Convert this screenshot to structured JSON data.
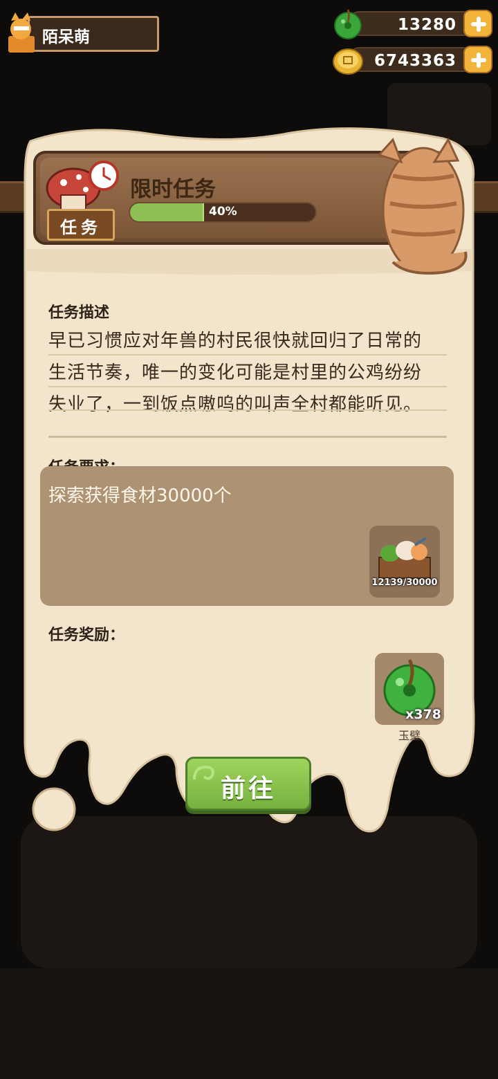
{
  "player": {
    "name": "陌呆萌"
  },
  "currencies": {
    "jade": {
      "value": "13280",
      "icon": "jade-disc-icon"
    },
    "coin": {
      "value": "6743363",
      "icon": "coin-icon"
    }
  },
  "task": {
    "badge_label": "任务",
    "title": "限时任务",
    "progress_percent": 40,
    "progress_text": "40%",
    "description_label": "任务描述",
    "description_lines": [
      "早已习惯应对年兽的村民很快就回归了日常的",
      "生活节奏，唯一的变化可能是村里的公鸡纷纷",
      "失业了，一到饭点嗷呜的叫声全村都能听见。"
    ],
    "requirement_label": "任务要求：",
    "requirement_text": "探索获得食材30000个",
    "requirement_item": {
      "icon": "ingredient-crate-icon",
      "progress": "12139/30000"
    },
    "reward_label": "任务奖励：",
    "reward_item": {
      "icon": "jade-disc-icon",
      "quantity": "x378",
      "name": "玉璧"
    },
    "go_button_label": "前往"
  },
  "colors": {
    "parchment": "#f3e4cc",
    "wood": "#7b5637",
    "progress_fill": "#8ebf52",
    "button_green": "#86c24a",
    "gold": "#f2b43a"
  }
}
